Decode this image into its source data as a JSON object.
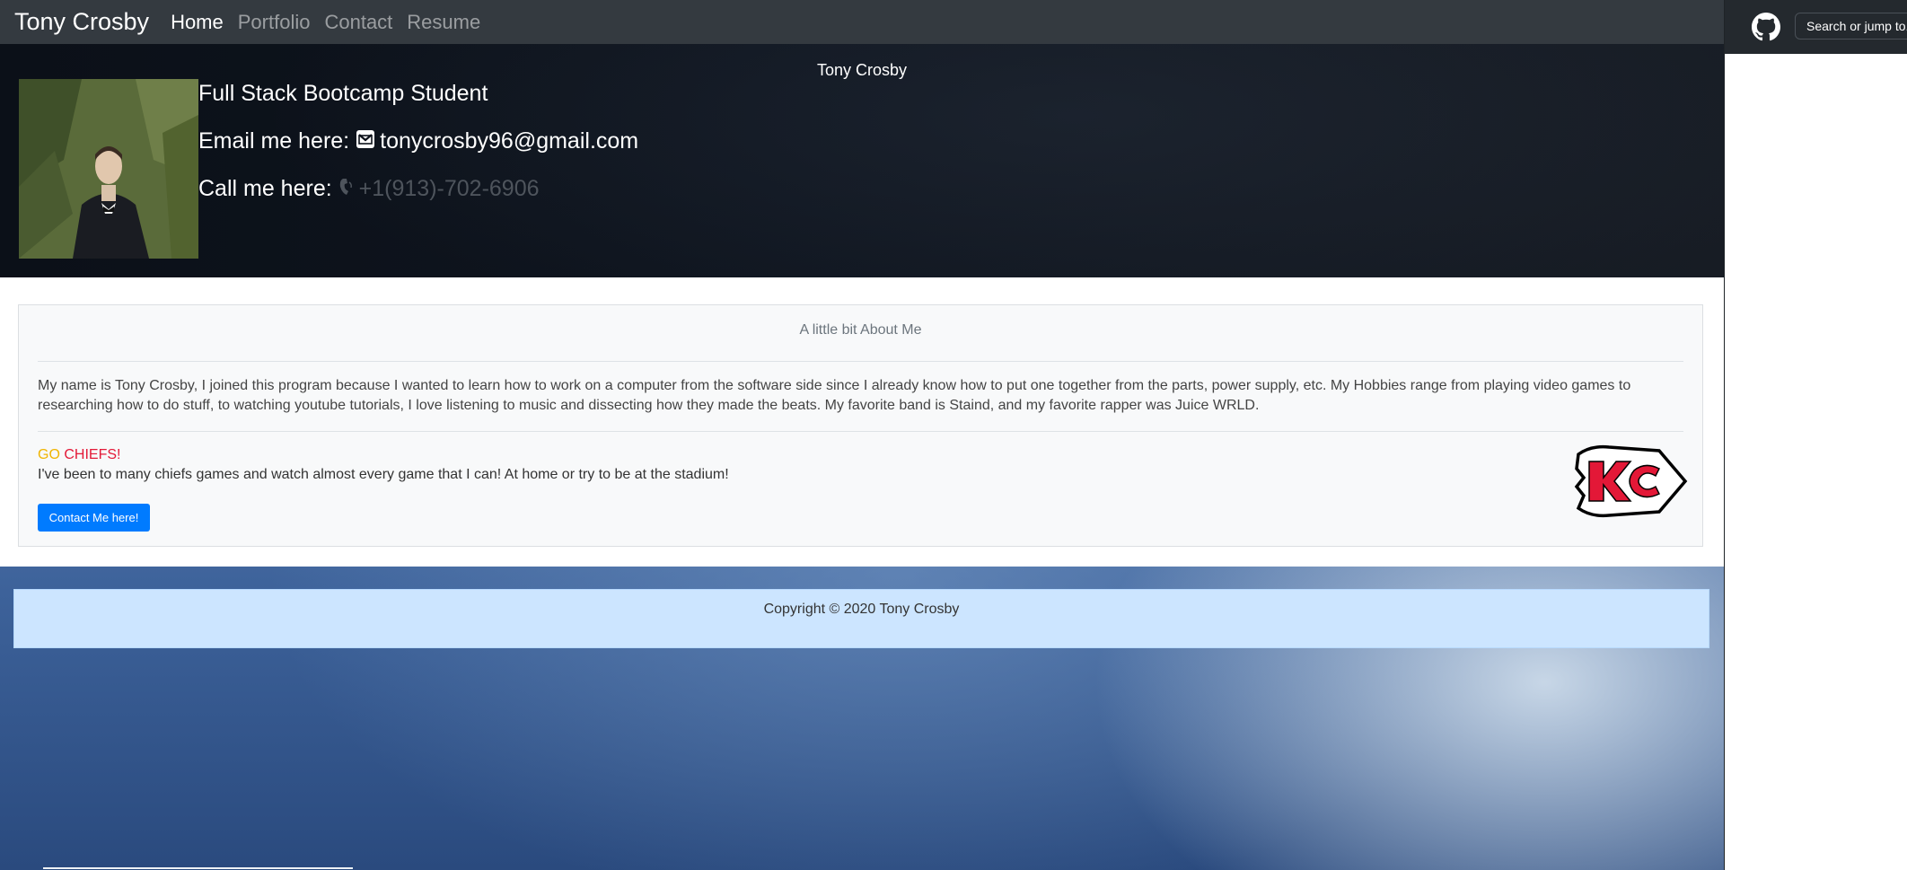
{
  "navbar": {
    "brand": "Tony Crosby",
    "links": [
      "Home",
      "Portfolio",
      "Contact",
      "Resume"
    ]
  },
  "jumbotron": {
    "name": "Tony Crosby",
    "role": "Full Stack Bootcamp Student",
    "email_prefix": "Email me here:",
    "email": "tonycrosby96@gmail.com",
    "phone_prefix": "Call me here:",
    "phone": "+1(913)-702-6906"
  },
  "about": {
    "title": "A little bit About Me",
    "text": "My name is Tony Crosby, I joined this program because I wanted to learn how to work on a computer from the software side since I already know how to put one together from the parts, power supply, etc. My Hobbies range from playing video games to researching how to do stuff, to watching youtube tutorials, I love listening to music and dissecting how they made the beats. My favorite band is Staind, and my favorite rapper was Juice WRLD.",
    "go": "GO",
    "chiefs": "CHIEFS!",
    "games_text": "I've been to many chiefs games and watch almost every game that I can! At home or try to be at the stadium!",
    "button_label": "Contact Me here!"
  },
  "footer": {
    "copyright": "Copyright © 2020 Tony Crosby"
  },
  "github_panel": {
    "search_placeholder": "Search or jump to..."
  },
  "colors": {
    "navbar": "#343a40",
    "button": "#007bff",
    "footer": "#cce5ff",
    "gold": "#f0b400",
    "red": "#e31837"
  },
  "icons": [
    "github-icon",
    "envelope-icon",
    "phone-icon",
    "chiefs-logo"
  ]
}
